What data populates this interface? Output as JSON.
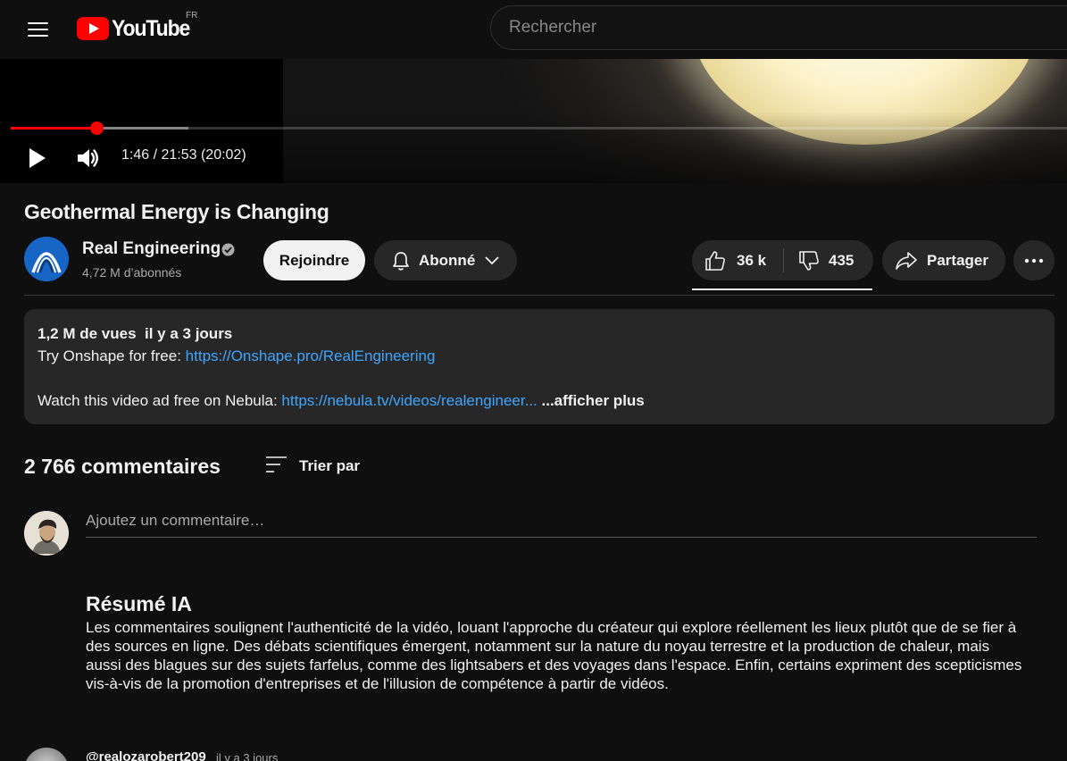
{
  "header": {
    "logo_text": "YouTube",
    "country_code": "FR",
    "search_placeholder": "Rechercher"
  },
  "player": {
    "progress_fraction": 0.0811,
    "buffered_fraction": 0.168,
    "time_display": "1:46 / 21:53 (20:02)",
    "colors": {
      "progress": "#ff0000"
    }
  },
  "video": {
    "title": "Geothermal Energy is Changing"
  },
  "channel": {
    "name": "Real Engineering",
    "subscribers": "4,72 M d’abonnés",
    "avatar_color": "#1766c6"
  },
  "actions": {
    "join_label": "Rejoindre",
    "subscribe_label": "Abonné",
    "like_count": "36 k",
    "dislike_count": "435",
    "share_label": "Partager"
  },
  "description": {
    "meta": "1,2 M de vues  il y a 3 jours",
    "line1_text": "Try Onshape for free: ",
    "line1_link": "https://Onshape.pro/RealEngineering",
    "line2_text": "Watch this video ad free on Nebula: ",
    "line2_link": "https://nebula.tv/videos/realengineer...",
    "show_more": " ...afficher plus"
  },
  "comments": {
    "count_label": "2 766 commentaires",
    "sort_label": "Trier par",
    "add_placeholder": "Ajoutez un commentaire…"
  },
  "ai_summary": {
    "title": "Résumé IA",
    "text": "Les commentaires soulignent l'authenticité de la vidéo, louant l'approche du créateur qui explore réellement les lieux plutôt que de se fier à des sources en ligne. Des débats scientifiques émergent, notamment sur la nature du noyau terrestre et la production de chaleur, mais aussi des blagues sur des sujets farfelus, comme des lightsabers et des voyages dans l'espace. Enfin, certains expriment des scepticismes vis-à-vis de la promotion d'entreprises et de l'illusion de compétence à partir de vidéos."
  },
  "first_comment": {
    "author": "@realozarobert209",
    "time": "il y a 3 jours"
  },
  "icons": {
    "menu": "hamburger-menu-icon",
    "logo": "youtube-play-icon",
    "play": "play-icon",
    "volume": "volume-icon",
    "verified": "verified-check-icon",
    "bell": "bell-icon",
    "chevron": "chevron-down-icon",
    "like": "thumbs-up-icon",
    "dislike": "thumbs-down-icon",
    "share": "share-arrow-icon",
    "more": "more-horizontal-icon",
    "sort": "sort-lines-icon"
  }
}
